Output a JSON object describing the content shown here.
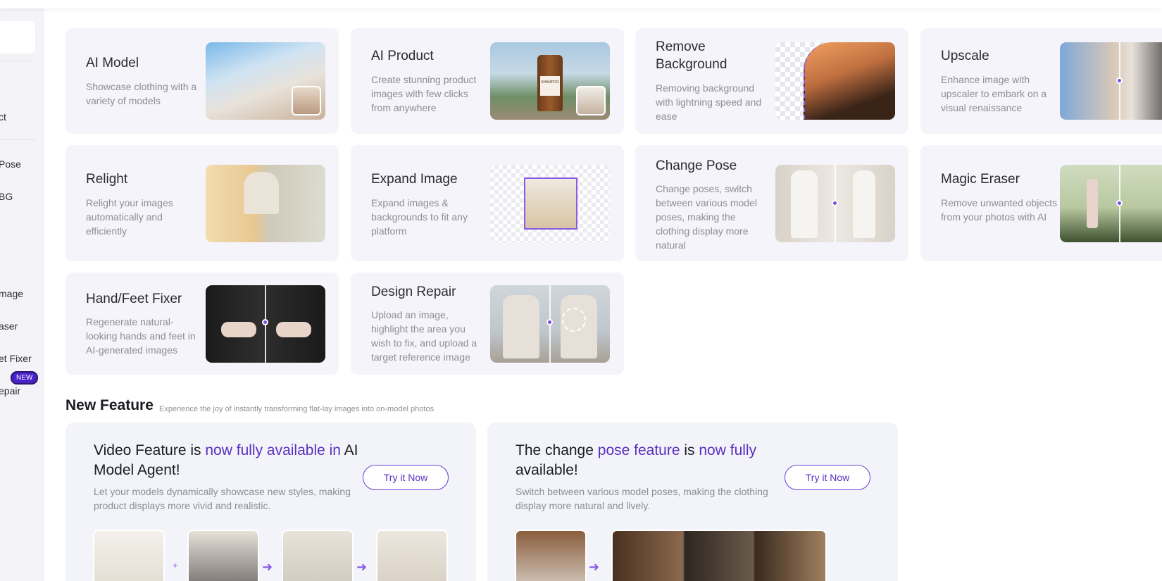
{
  "sidebar": {
    "items": [
      {
        "label": "ct"
      },
      {
        "label": "Pose"
      },
      {
        "label": "BG"
      },
      {
        "label": "mage"
      },
      {
        "label": "aser"
      },
      {
        "label": "et Fixer"
      },
      {
        "label": "epair"
      }
    ],
    "new_badge": "NEW"
  },
  "tools": [
    {
      "title": "AI Model",
      "desc": "Showcase clothing with a variety of models"
    },
    {
      "title": "AI Product",
      "desc": "Create stunning product images with few clicks from anywhere"
    },
    {
      "title": "Remove Background",
      "desc": "Removing background with lightning speed and ease"
    },
    {
      "title": "Upscale",
      "desc": "Enhance image with upscaler to embark on a visual renaissance"
    },
    {
      "title": "Relight",
      "desc": "Relight your images automatically and efficiently"
    },
    {
      "title": "Expand Image",
      "desc": "Expand images & backgrounds to fit any platform"
    },
    {
      "title": "Change Pose",
      "desc": "Change poses, switch between various model poses, making the clothing display more natural"
    },
    {
      "title": "Magic Eraser",
      "desc": "Remove unwanted objects from your photos with AI"
    },
    {
      "title": "Hand/Feet Fixer",
      "desc": "Regenerate natural-looking hands and feet in AI-generated images"
    },
    {
      "title": "Design Repair",
      "desc": "Upload an image, highlight the area you wish to fix, and upload a target reference image"
    }
  ],
  "product_label": "SHAMPOO",
  "new_feature": {
    "heading": "New Feature",
    "subtitle": "Experience the joy of instantly transforming flat-lay images into on-model photos",
    "cards": [
      {
        "title_parts": [
          "Video Feature is ",
          "now fully available in",
          " AI Model Agent!"
        ],
        "desc": "Let your models dynamically showcase new styles, making product displays more vivid and realistic.",
        "button": "Try it Now"
      },
      {
        "title_parts": [
          "The change ",
          "pose feature",
          " is ",
          "now fully",
          " available!"
        ],
        "desc": "Switch between various model poses, making the clothing display more natural and lively.",
        "button": "Try it Now"
      }
    ]
  },
  "colors": {
    "accent": "#5a2fbf",
    "card_bg": "#f4f4fa"
  }
}
